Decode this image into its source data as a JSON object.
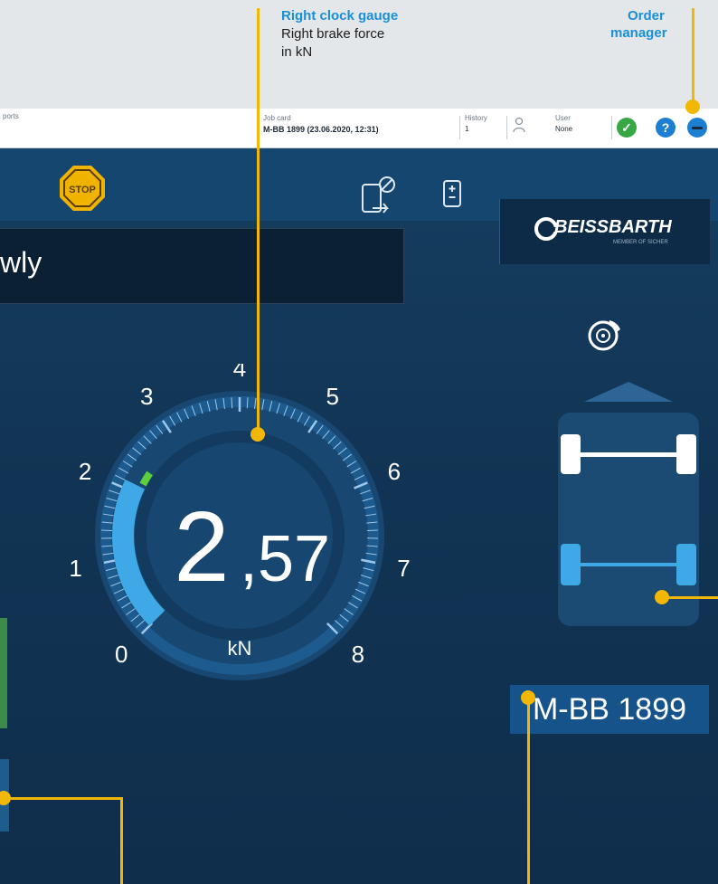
{
  "callouts": {
    "right_clock_gauge": {
      "title": "Right clock gauge",
      "desc_line1": "Right brake force",
      "desc_line2": "in kN"
    },
    "order_manager": {
      "title_line1": "Order",
      "title_line2": "manager"
    }
  },
  "topbar": {
    "left_fragment": "ports",
    "job_card_label": "Job card",
    "job_card_value": "M-BB 1899 (23.06.2020, 12:31)",
    "history_label": "History",
    "history_value": "1",
    "user_label": "User",
    "user_value": "None"
  },
  "screen": {
    "stop_label": "STOP",
    "prompt_text": "wly",
    "brand": "BEISSBARTH",
    "brand_sub": "MEMBER OF SICHER"
  },
  "gauge": {
    "value_integer": "2",
    "value_decimal": ",57",
    "unit": "kN",
    "value": 2.57,
    "max": 8,
    "tick_labels": [
      "0",
      "1",
      "2",
      "3",
      "4",
      "5",
      "6",
      "7",
      "8"
    ]
  },
  "plate": "M-BB 1899",
  "colors": {
    "accent_yellow": "#f2b705",
    "callout_blue": "#1a8fd6",
    "screen_bg": "#133a5c",
    "gauge_fill": "#3ea9e6",
    "green_ok": "#38a845",
    "help_blue": "#1c7fd1"
  }
}
